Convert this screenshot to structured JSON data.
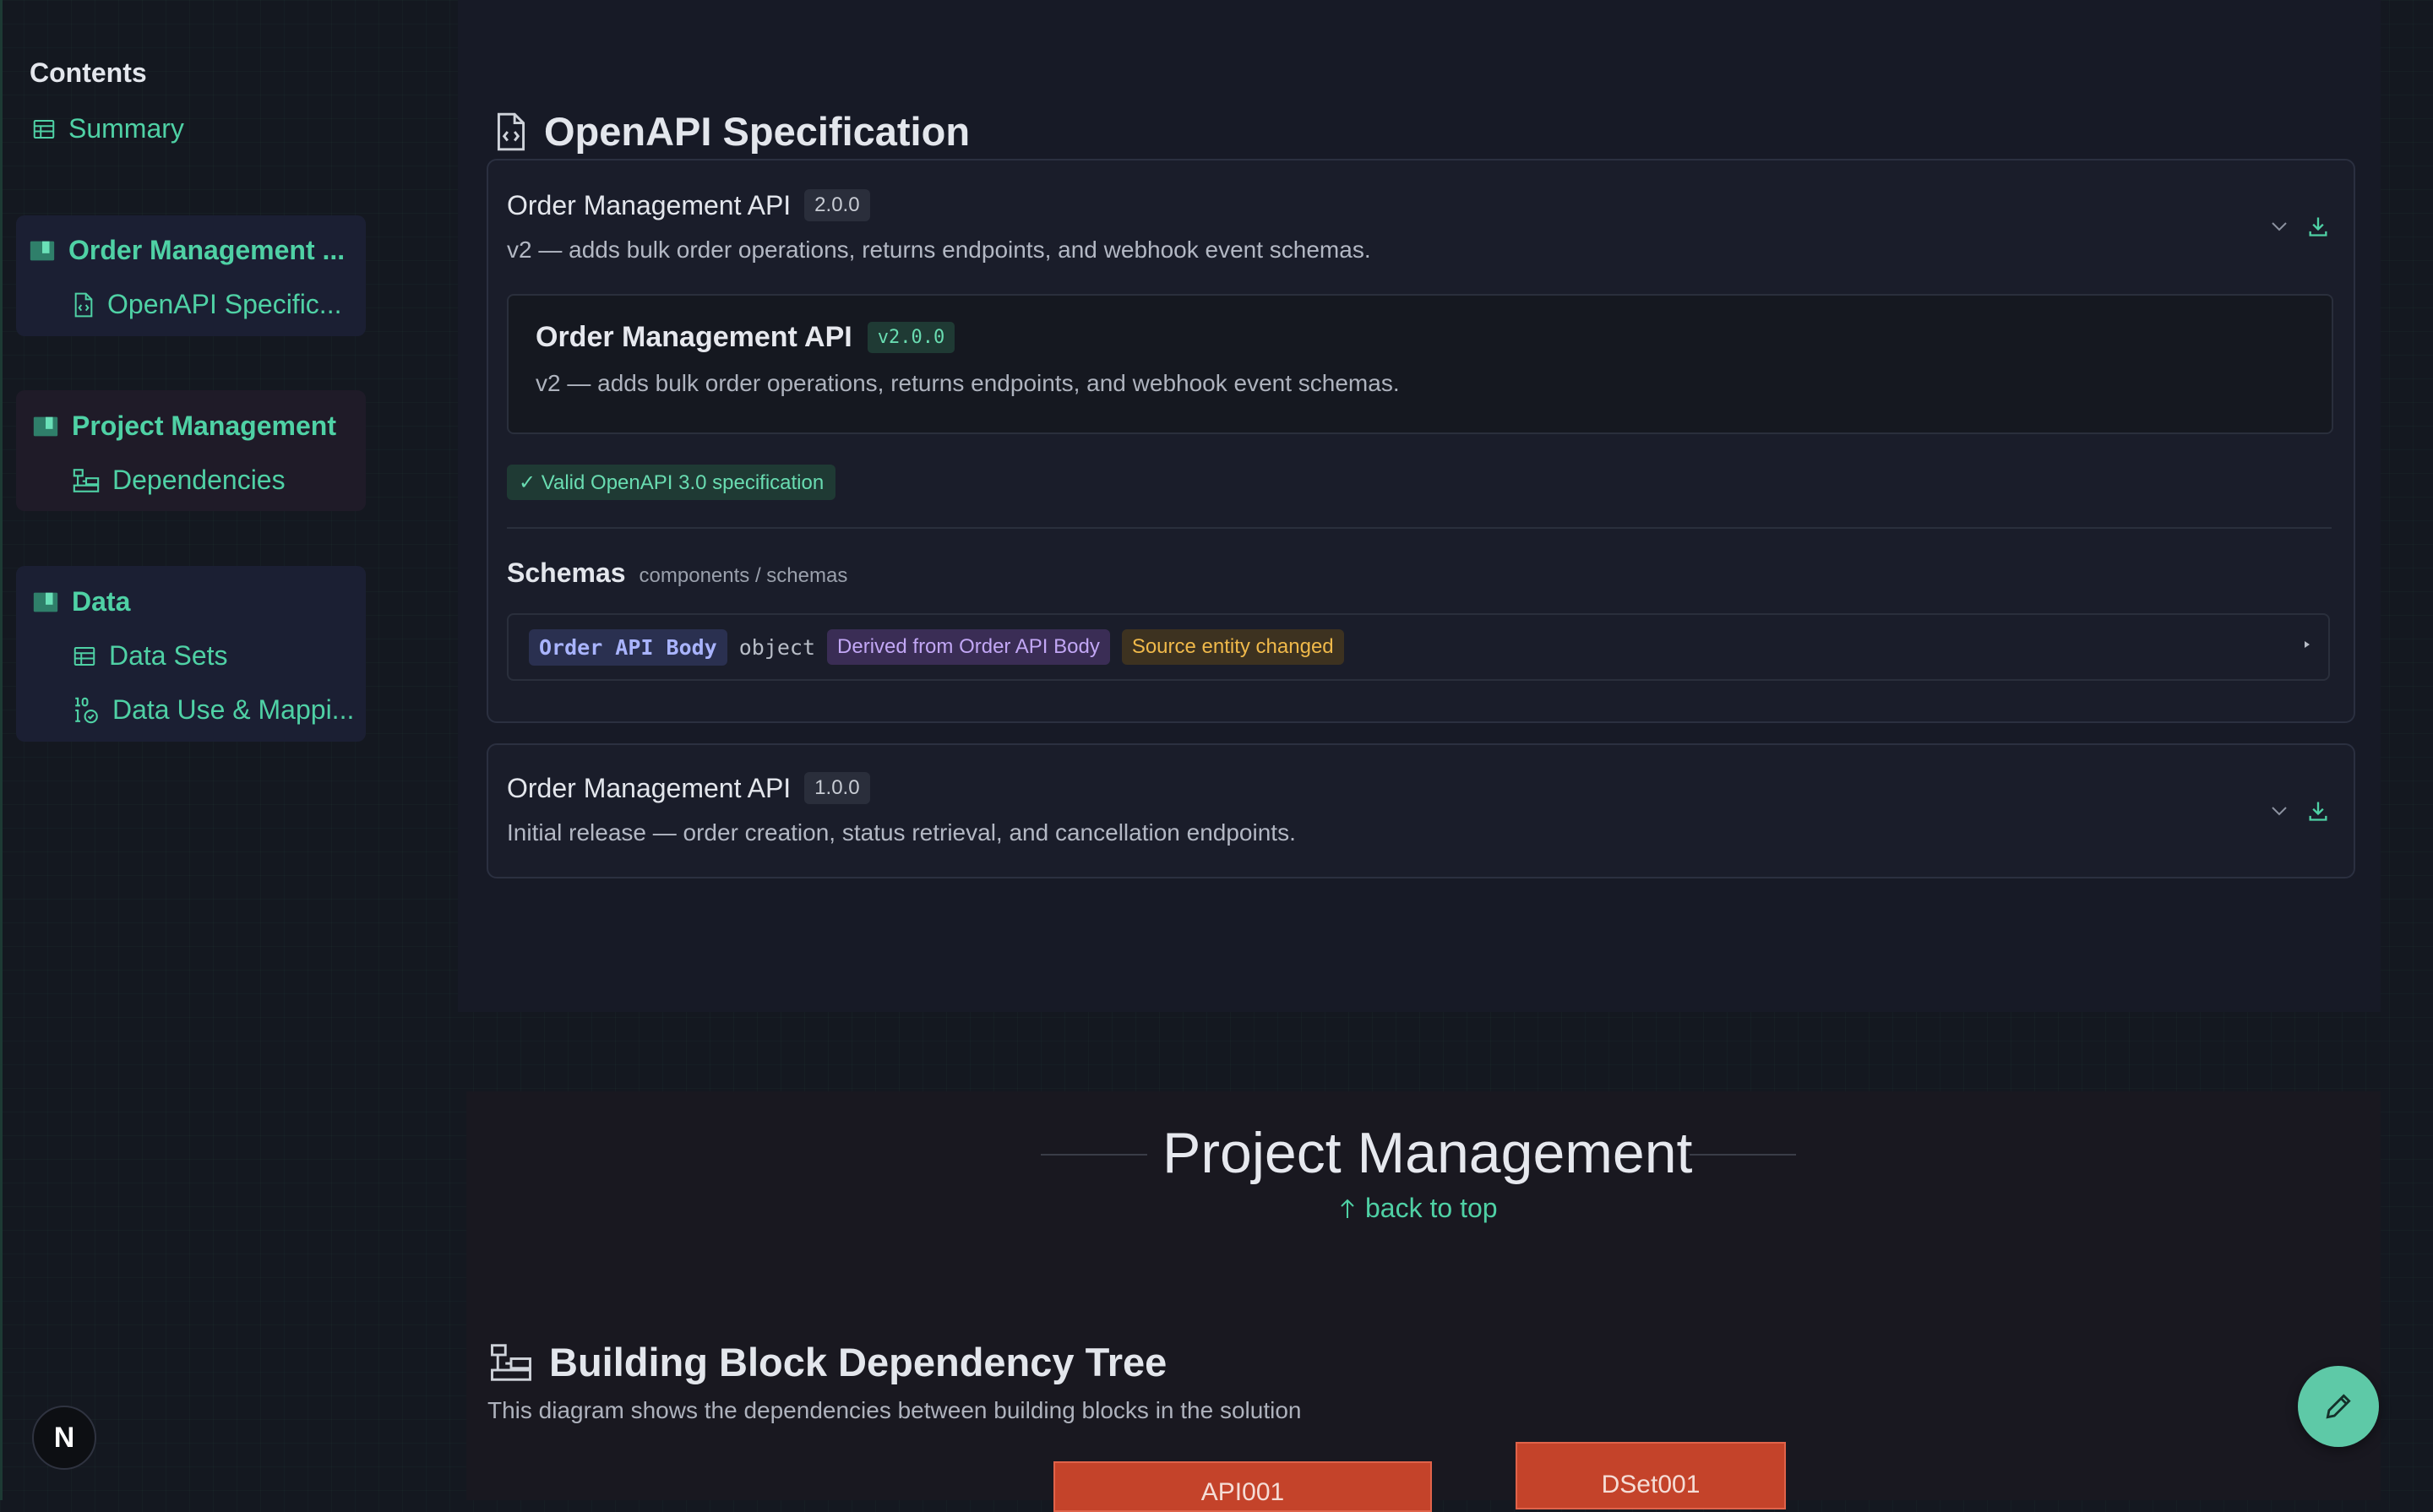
{
  "sidebar": {
    "heading": "Contents",
    "summary": "Summary",
    "groups": [
      {
        "title": "Order Management ...",
        "items": [
          "OpenAPI Specific..."
        ]
      },
      {
        "title": "Project Management",
        "items": [
          "Dependencies"
        ]
      },
      {
        "title": "Data",
        "items": [
          "Data Sets",
          "Data Use & Mappi..."
        ]
      }
    ]
  },
  "openapi": {
    "title": "OpenAPI Specification",
    "cards": [
      {
        "name": "Order Management API",
        "version": "2.0.0",
        "description": "v2 — adds bulk order operations, returns endpoints, and webhook event schemas."
      },
      {
        "name": "Order Management API",
        "version": "1.0.0",
        "description": "Initial release — order creation, status retrieval, and cancellation endpoints."
      }
    ],
    "detail": {
      "name": "Order Management API",
      "version": "v2.0.0",
      "description": "v2 — adds bulk order operations, returns endpoints, and webhook event schemas.",
      "valid_badge": "✓ Valid OpenAPI 3.0 specification",
      "schemas_label": "Schemas",
      "schemas_path": "components / schemas",
      "schema": {
        "name": "Order API Body",
        "type": "object",
        "derived": "Derived from Order API Body",
        "status": "Source entity changed"
      }
    }
  },
  "project": {
    "title": "Project Management",
    "back_to_top": "back to top",
    "dep_title": "Building Block Dependency Tree",
    "dep_desc": "This diagram shows the dependencies between building blocks in the solution",
    "nodes": [
      "API001",
      "DSet001"
    ]
  },
  "badge_letter": "N",
  "colors": {
    "accent": "#4fd1a5",
    "node": "#c4432a",
    "fab": "#5ec9a7"
  }
}
